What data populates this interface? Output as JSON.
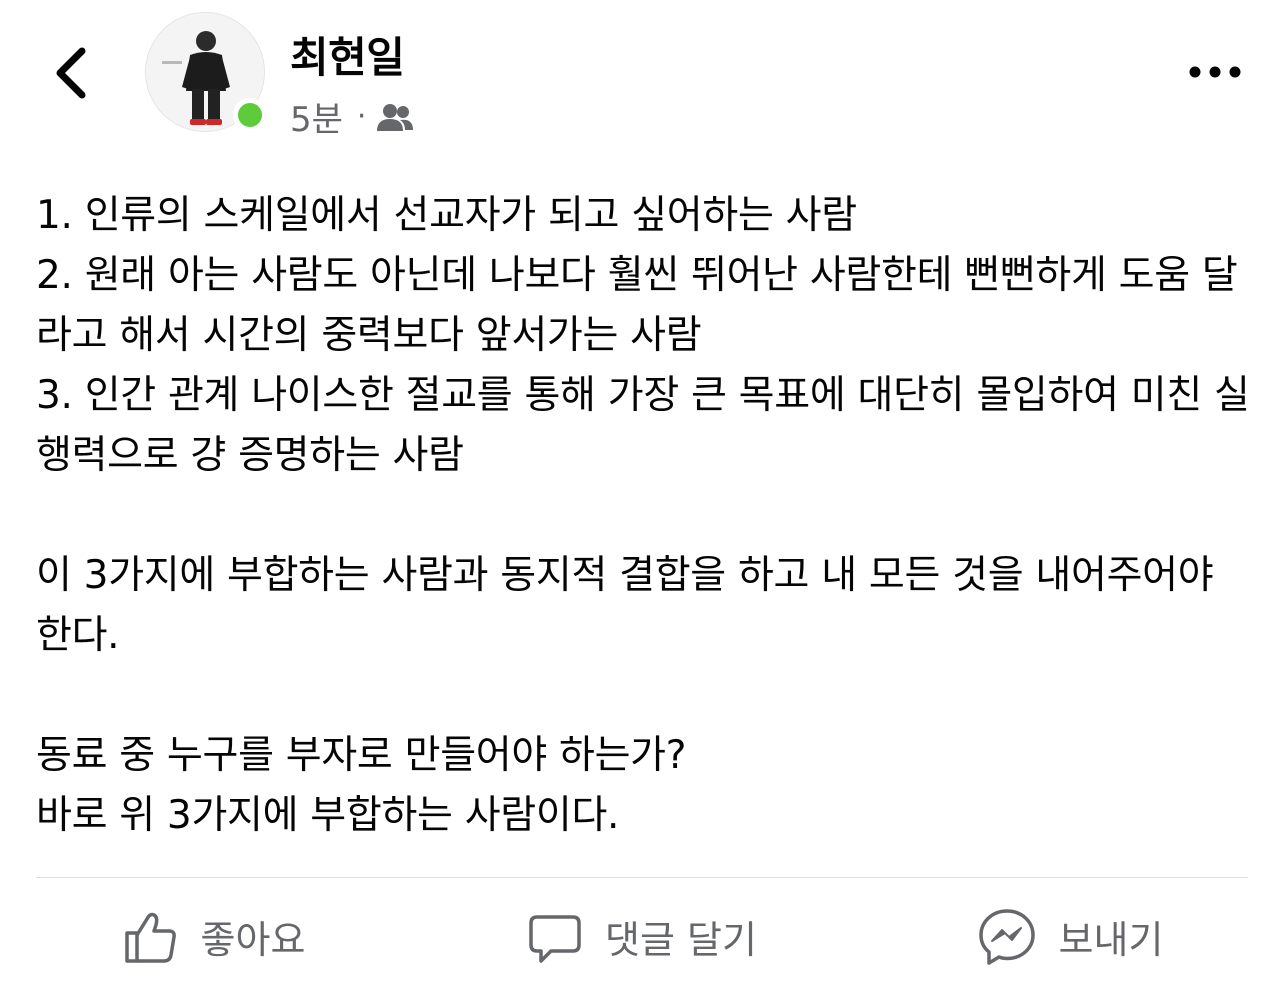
{
  "header": {
    "author_name": "최현일",
    "timestamp": "5분",
    "separator": "·",
    "audience_icon": "friends-icon",
    "back_icon": "chevron-left-icon",
    "more_icon": "more-dots-icon",
    "online_status_color": "#5ecb3b"
  },
  "post": {
    "paragraphs": [
      "1. 인류의 스케일에서 선교자가 되고 싶어하는 사람\n2. 원래 아는 사람도 아닌데 나보다 훨씬 뛰어난 사람한테 뻔뻔하게 도움 달라고 해서 시간의 중력보다 앞서가는 사람\n3. 인간 관계 나이스한 절교를 통해 가장 큰 목표에 대단히 몰입하여 미친 실행력으로 걍 증명하는 사람",
      "이 3가지에 부합하는 사람과 동지적 결합을 하고 내 모든 것을 내어주어야 한다.",
      "동료 중 누구를 부자로 만들어야 하는가?\n바로 위 3가지에 부합하는 사람이다."
    ]
  },
  "actions": {
    "like_label": "좋아요",
    "comment_label": "댓글 달기",
    "share_label": "보내기",
    "like_icon": "thumbs-up-icon",
    "comment_icon": "comment-bubble-icon",
    "share_icon": "messenger-icon"
  },
  "colors": {
    "text_primary": "#050505",
    "text_secondary": "#65676b",
    "divider": "#dadde1"
  }
}
